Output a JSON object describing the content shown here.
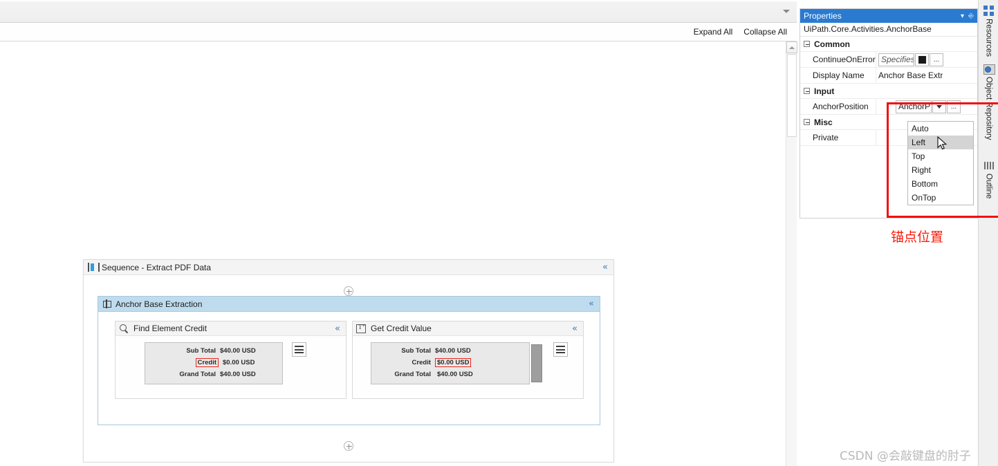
{
  "toolbar": {
    "expand_all": "Expand All",
    "collapse_all": "Collapse All"
  },
  "canvas": {
    "sequence": {
      "title": "Sequence - Extract PDF Data",
      "icon": "sequence-icon",
      "collapse_glyph": "«"
    },
    "anchor_base": {
      "title": "Anchor Base Extraction",
      "icon": "anchor-icon",
      "collapse_glyph": "«"
    },
    "activities": [
      {
        "title": "Find Element Credit",
        "icon": "magnifier-icon",
        "collapse_glyph": "«",
        "preview": {
          "rows": [
            {
              "label": "Sub Total",
              "value": "$40.00 USD",
              "highlight": "none"
            },
            {
              "label": "Credit",
              "value": "$0.00 USD",
              "highlight": "label"
            },
            {
              "label": "Grand Total",
              "value": "$40.00 USD",
              "highlight": "none"
            }
          ],
          "has_scrollbar": false
        }
      },
      {
        "title": "Get Credit Value",
        "icon": "get-text-icon",
        "collapse_glyph": "«",
        "preview": {
          "rows": [
            {
              "label": "Sub Total",
              "value": "$40.00 USD",
              "highlight": "none"
            },
            {
              "label": "Credit",
              "value": "$0.00 USD",
              "highlight": "value"
            },
            {
              "label": "Grand Total",
              "value": "$40.00 USD",
              "highlight": "none"
            }
          ],
          "has_scrollbar": true
        }
      }
    ]
  },
  "properties": {
    "panel_title": "Properties",
    "dropdown_glyph": "▾",
    "pin_glyph": "⚓",
    "type_name": "UiPath.Core.Activities.AnchorBase",
    "groups": [
      {
        "name": "Common"
      },
      {
        "name": "Input"
      },
      {
        "name": "Misc"
      }
    ],
    "rows": {
      "continue_on_error": {
        "name": "ContinueOnError",
        "value": "Specifies",
        "ellipsis": "..."
      },
      "display_name": {
        "name": "Display Name",
        "value": "Anchor Base Extr"
      },
      "anchor_position": {
        "name": "AnchorPosition",
        "value": "AnchorP",
        "ellipsis": "..."
      },
      "private": {
        "name": "Private"
      }
    },
    "dropdown": {
      "options": [
        "Auto",
        "Left",
        "Top",
        "Right",
        "Bottom",
        "OnTop"
      ],
      "selected": "Left"
    }
  },
  "annotation": {
    "note_text": "锚点位置",
    "note_color": "#fa1a0a",
    "rect_color": "#f30c0c"
  },
  "right_tabs": [
    {
      "label": "Resources",
      "icon": "resources-icon"
    },
    {
      "label": "Object Repository",
      "icon": "object-repository-icon"
    },
    {
      "label": "Outline",
      "icon": "outline-icon"
    }
  ],
  "watermark": "CSDN @会敲键盘的肘子",
  "colors": {
    "accent_blue": "#2a7bd0",
    "anchor_header": "#bfdcee",
    "red_annotation": "#f30c0c",
    "highlight_red": "#e8261c"
  }
}
